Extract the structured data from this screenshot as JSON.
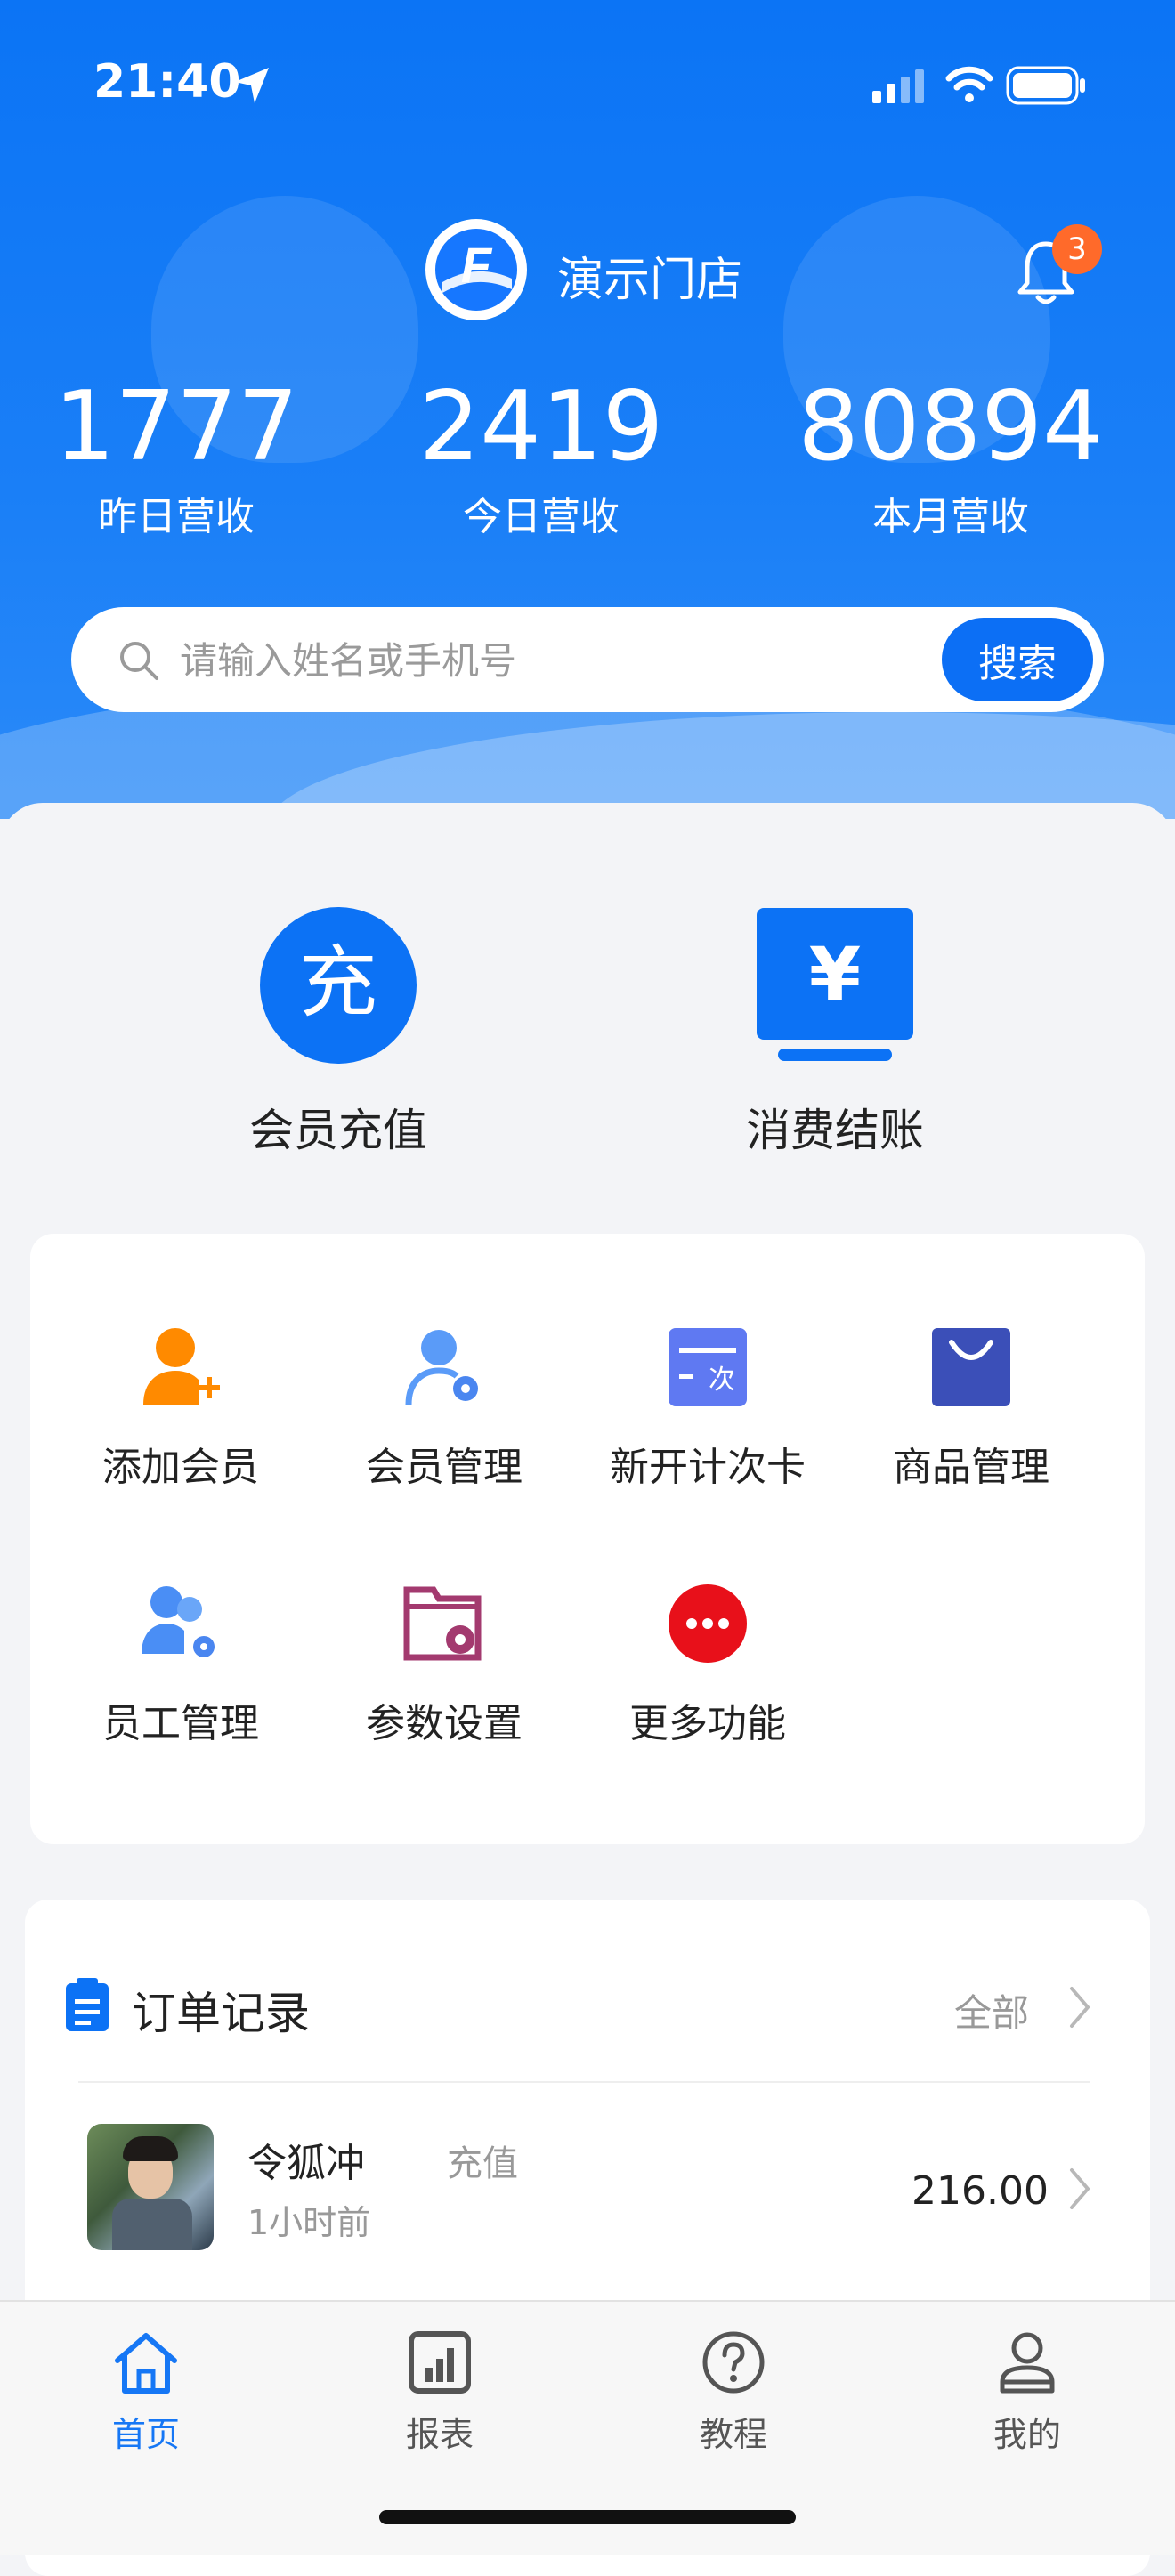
{
  "status_bar": {
    "time": "21:40"
  },
  "header": {
    "store_name": "演示门店",
    "notification_count": "3",
    "stats": [
      {
        "value": "1777",
        "label": "昨日营收"
      },
      {
        "value": "2419",
        "label": "今日营收"
      },
      {
        "value": "80894",
        "label": "本月营收"
      }
    ],
    "search": {
      "placeholder": "请输入姓名或手机号",
      "button": "搜索"
    }
  },
  "quick_actions": [
    {
      "label": "会员充值",
      "glyph": "充"
    },
    {
      "label": "消费结账",
      "glyph": "¥"
    }
  ],
  "grid": [
    {
      "label": "添加会员",
      "icon": "add-user-icon"
    },
    {
      "label": "会员管理",
      "icon": "member-settings-icon"
    },
    {
      "label": "新开计次卡",
      "icon": "count-card-icon",
      "glyph": "次"
    },
    {
      "label": "商品管理",
      "icon": "shopping-bag-icon"
    },
    {
      "label": "员工管理",
      "icon": "staff-icon"
    },
    {
      "label": "参数设置",
      "icon": "folder-gear-icon"
    },
    {
      "label": "更多功能",
      "icon": "more-icon"
    }
  ],
  "orders": {
    "title": "订单记录",
    "all_label": "全部",
    "items": [
      {
        "name": "令狐冲",
        "type": "充值",
        "time": "1小时前",
        "amount": "216.00"
      }
    ]
  },
  "tabs": [
    {
      "label": "首页",
      "active": true
    },
    {
      "label": "报表",
      "active": false
    },
    {
      "label": "教程",
      "active": false
    },
    {
      "label": "我的",
      "active": false
    }
  ],
  "colors": {
    "primary": "#0c6ff5",
    "orange": "#ff8a00",
    "red": "#e8101a",
    "purple": "#a33a6f",
    "indigo": "#3b4fb8"
  }
}
